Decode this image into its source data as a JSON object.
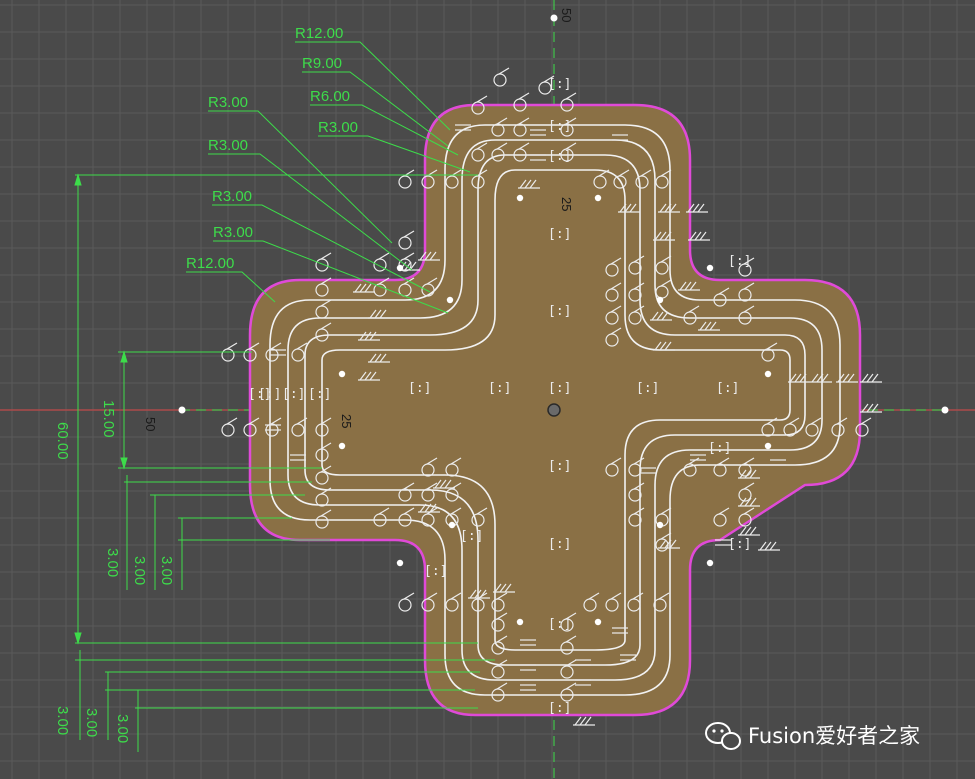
{
  "radius_labels": [
    "R12.00",
    "R9.00",
    "R6.00",
    "R3.00",
    "R3.00",
    "R3.00",
    "R3.00",
    "R3.00",
    "R12.00"
  ],
  "linear_dims": {
    "overall_height": "60.00",
    "arm_width": "15.00",
    "offset_a": "3.00",
    "offset_b": "3.00",
    "offset_c": "3.00",
    "offset_d": "3.00",
    "offset_e": "3.00",
    "offset_f": "3.00"
  },
  "axis_labels": {
    "top_v": "50",
    "left_h": "50",
    "inner_v": "25",
    "inner_h": "25"
  },
  "watermark": "Fusion爱好者之家",
  "colors": {
    "background": "#4a4a4a",
    "grid": "#5a5a5a",
    "profile_fill": "#8a7045",
    "profile_edge": "#e04ad8",
    "sketch_line": "#f2f2f2",
    "dimension": "#3ddc4a",
    "axis_h": "#c04a4a",
    "axis_v": "#3ddc4a"
  }
}
